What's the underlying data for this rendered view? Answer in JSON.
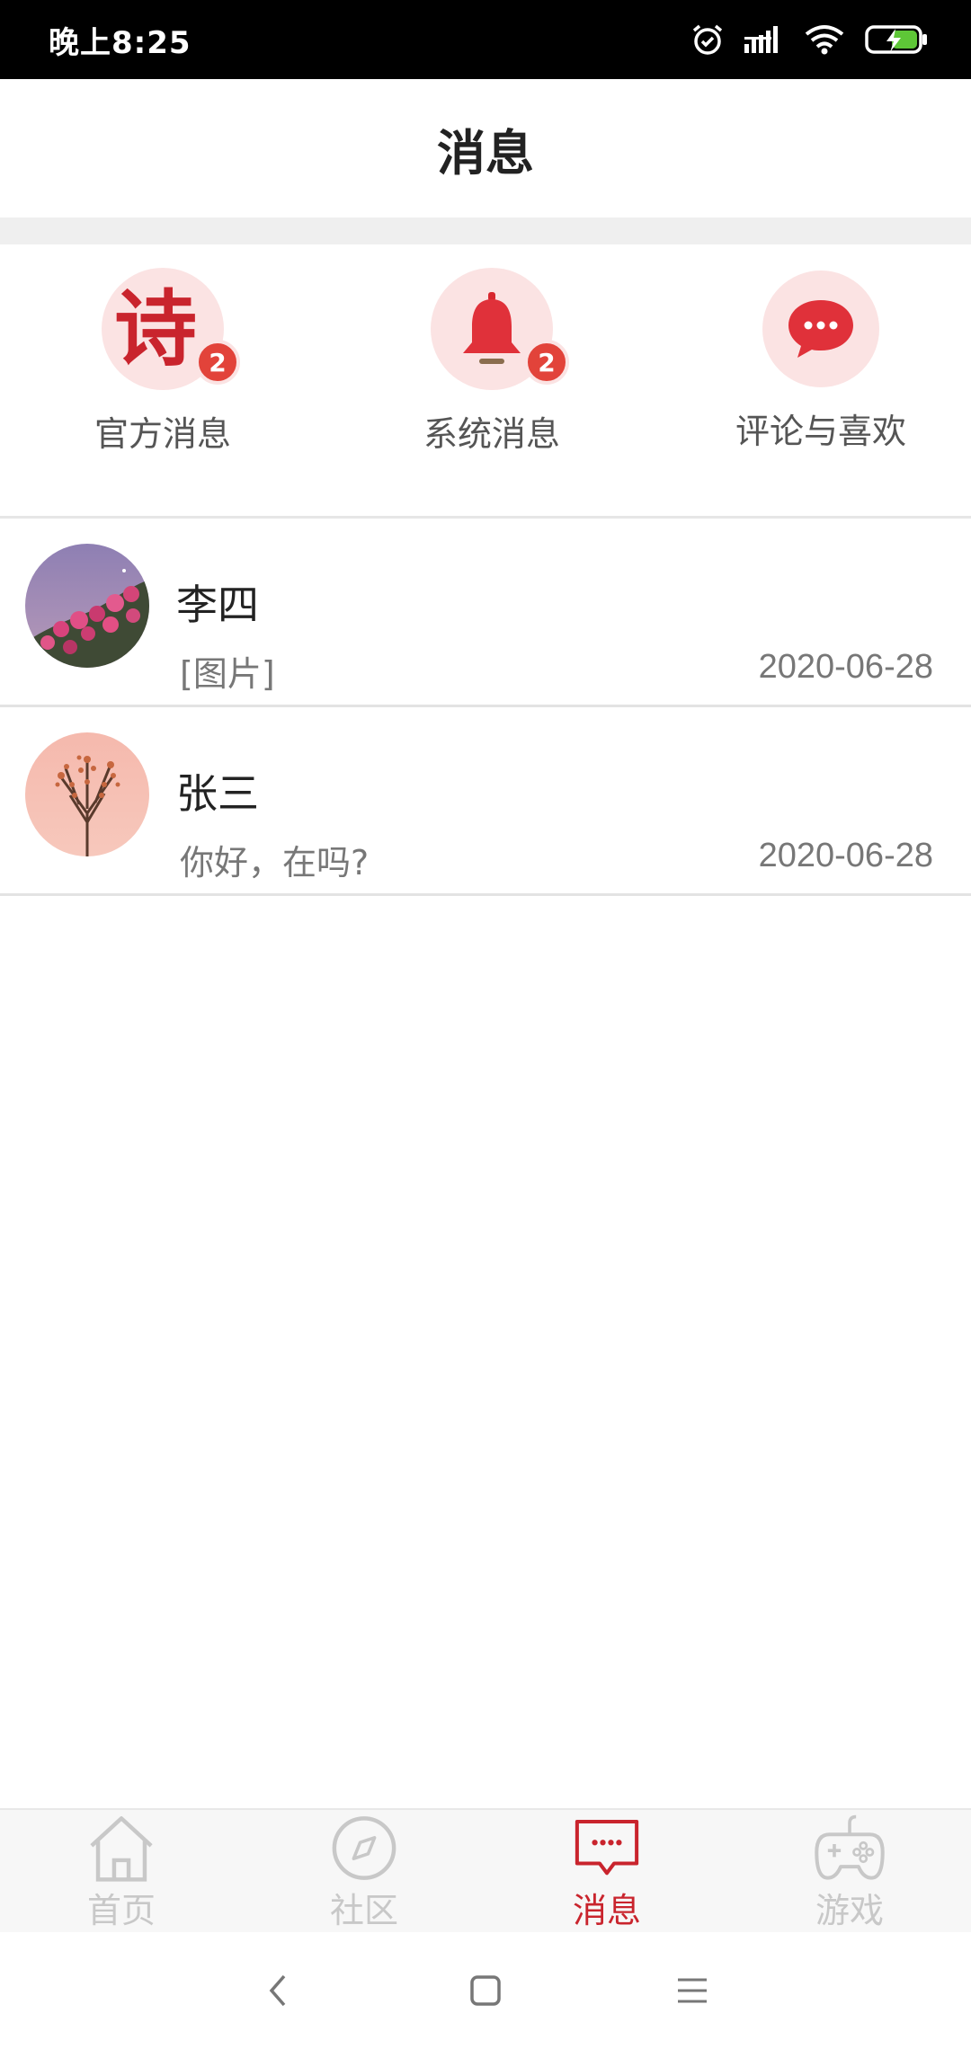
{
  "status_bar": {
    "time": "晚上8:25",
    "icons": [
      "alarm-icon",
      "signal-icon",
      "wifi-icon",
      "battery-charging-icon"
    ]
  },
  "header": {
    "title": "消息"
  },
  "categories": [
    {
      "label": "官方消息",
      "icon": "poem-icon",
      "glyph": "诗",
      "badge": "2"
    },
    {
      "label": "系统消息",
      "icon": "bell-icon",
      "badge": "2"
    },
    {
      "label": "评论与喜欢",
      "icon": "chat-bubble-icon"
    }
  ],
  "conversations": [
    {
      "name": "李四",
      "preview": "[图片]",
      "date": "2020-06-28",
      "avatar": "flowers-avatar"
    },
    {
      "name": "张三",
      "preview": "你好，在吗?",
      "date": "2020-06-28",
      "avatar": "tree-avatar"
    }
  ],
  "tabs": [
    {
      "label": "首页",
      "icon": "home-icon",
      "active": false
    },
    {
      "label": "社区",
      "icon": "compass-icon",
      "active": false
    },
    {
      "label": "消息",
      "icon": "message-icon",
      "active": true
    },
    {
      "label": "游戏",
      "icon": "gamepad-icon",
      "active": false
    }
  ],
  "colors": {
    "accent": "#c9242d",
    "badge": "#e2433a",
    "icon_bg": "#fbe3e3",
    "inactive_tab": "#c8c8c8"
  }
}
